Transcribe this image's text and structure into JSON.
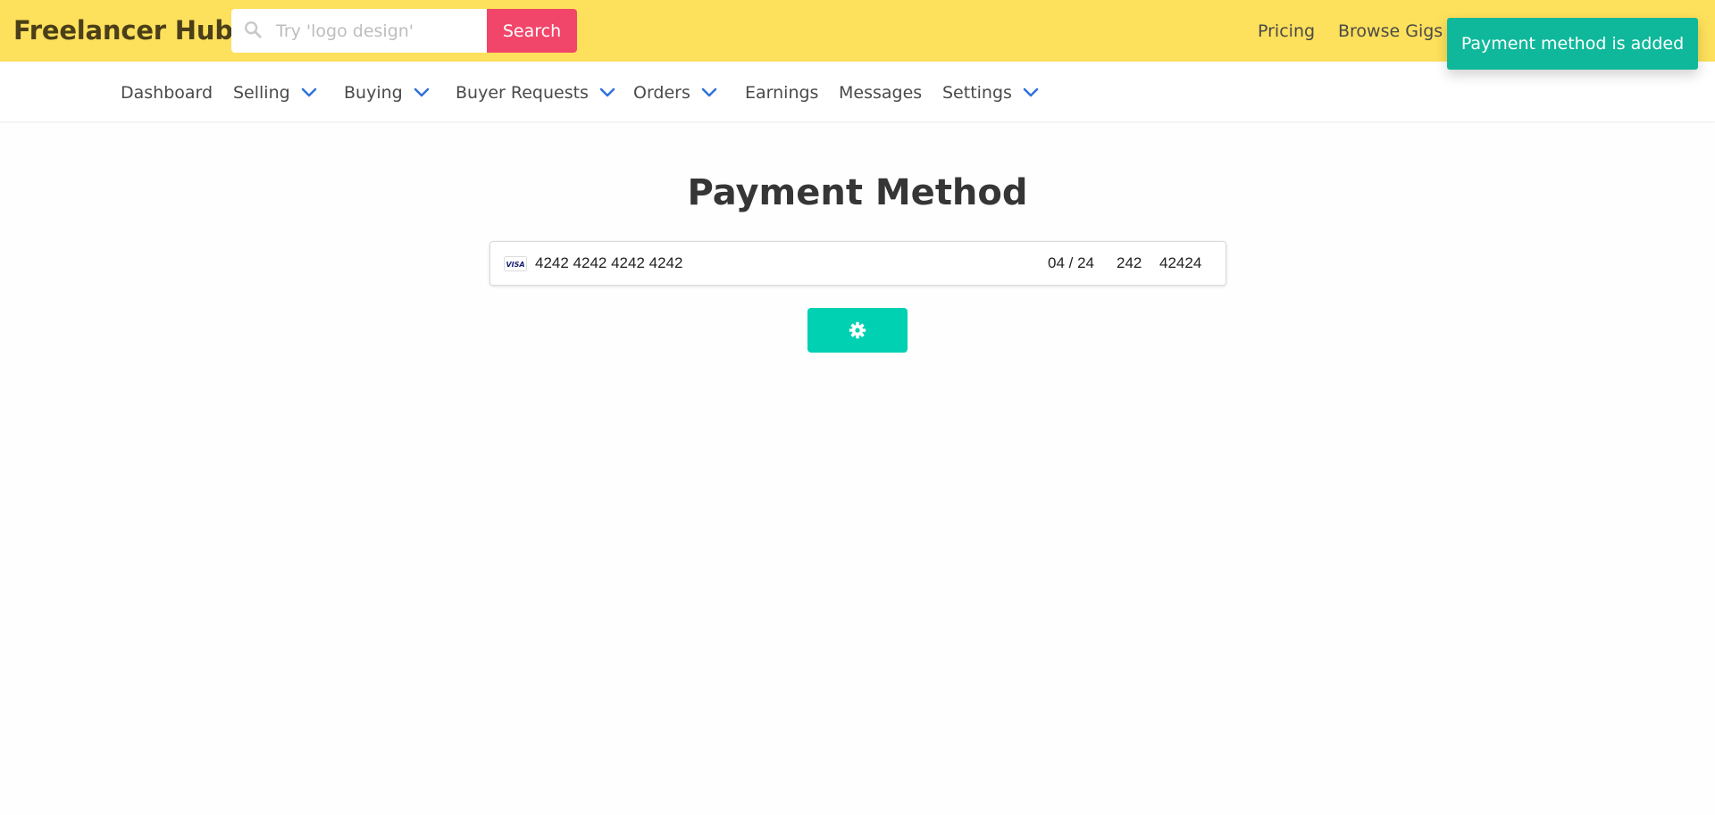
{
  "header": {
    "brand": "Freelancer Hub",
    "search": {
      "placeholder": "Try 'logo design'",
      "value": "",
      "button_label": "Search"
    },
    "links": [
      "Pricing",
      "Browse Gigs"
    ]
  },
  "toast": {
    "message": "Payment method is added"
  },
  "subnav": {
    "items": [
      {
        "label": "Dashboard",
        "dropdown": false
      },
      {
        "label": "Selling",
        "dropdown": true
      },
      {
        "label": "Buying",
        "dropdown": true
      },
      {
        "label": "Buyer Requests",
        "dropdown": true
      },
      {
        "label": "Orders",
        "dropdown": true
      },
      {
        "label": "Earnings",
        "dropdown": false
      },
      {
        "label": "Messages",
        "dropdown": false
      },
      {
        "label": "Settings",
        "dropdown": true
      }
    ]
  },
  "main": {
    "title": "Payment Method",
    "card": {
      "brand_icon": "visa-icon",
      "brand_text": "VISA",
      "number": "4242 4242 4242 4242",
      "expiry": "04 / 24",
      "cvc": "242",
      "zip": "42424"
    },
    "save_button_icon": "gear-icon"
  },
  "colors": {
    "topbar": "#fde05b",
    "search_button": "#f1466a",
    "toast": "#10b89b",
    "primary_button": "#00d1b2",
    "chevron": "#3273dc"
  }
}
